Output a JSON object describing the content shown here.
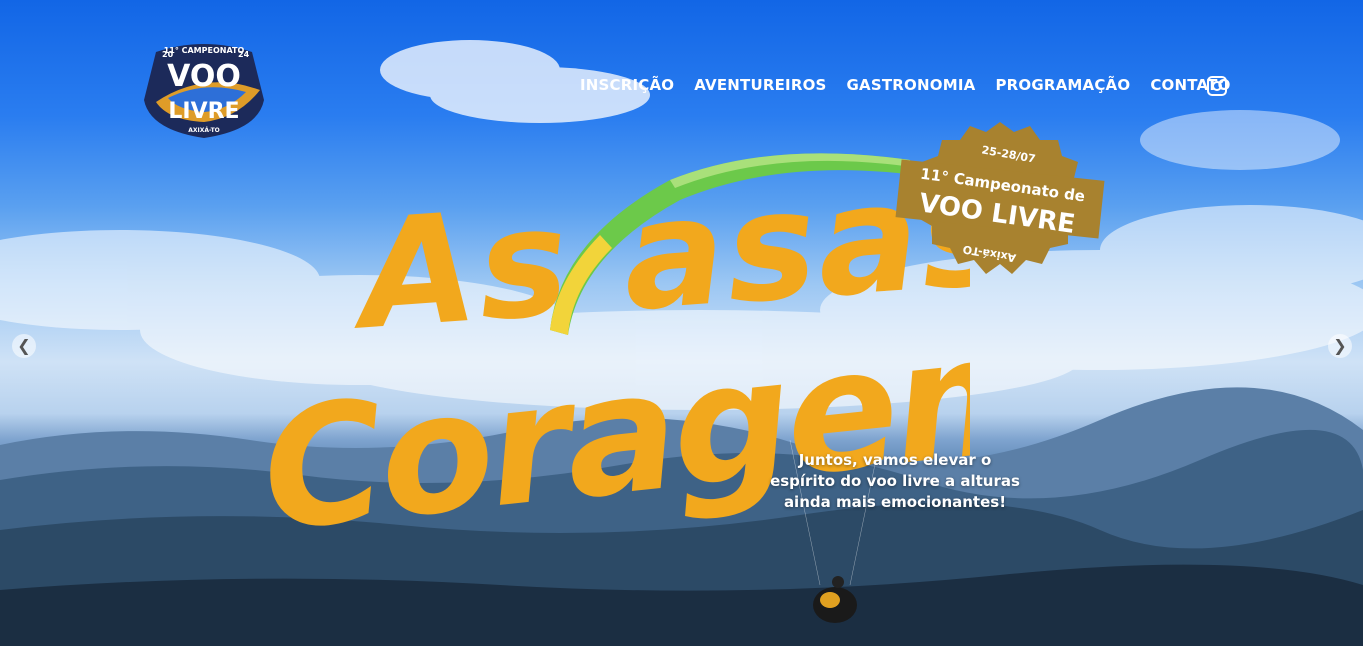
{
  "logo": {
    "year_left": "20",
    "edition": "11° CAMPEONATO",
    "year_right": "24",
    "line1": "VOO",
    "line2": "LIVRE",
    "location": "AXIXÁ-TO"
  },
  "nav": {
    "items": [
      {
        "label": "INSCRIÇÃO"
      },
      {
        "label": "AVENTUREIROS"
      },
      {
        "label": "GASTRONOMIA"
      },
      {
        "label": "PROGRAMAÇÃO"
      },
      {
        "label": "CONTATO"
      }
    ],
    "instagram_icon": "instagram-icon"
  },
  "hero": {
    "headline_line1": "As asas da",
    "headline_line2": "Coragem",
    "tagline": [
      "Juntos, vamos elevar o",
      "espírito do voo livre a alturas",
      "ainda mais emocionantes!"
    ],
    "headline_color": "#f2a81d"
  },
  "seal": {
    "dates": "25-28/07",
    "title": "11° Campeonato de",
    "subtitle": "VOO LIVRE",
    "location": "Axixá-TO",
    "color": "#a8822f"
  },
  "carousel": {
    "prev_icon": "chevron-left-icon",
    "next_icon": "chevron-right-icon"
  }
}
